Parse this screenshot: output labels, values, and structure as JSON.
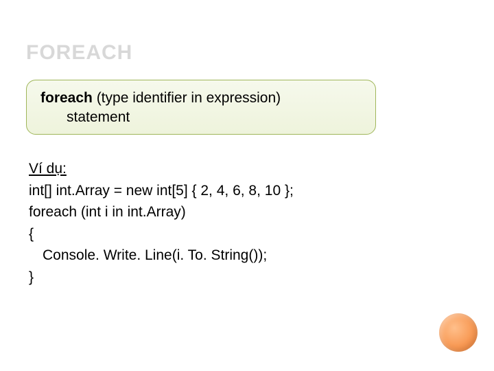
{
  "title": "FOREACH",
  "syntax": {
    "keyword": "foreach",
    "rest_line1": " (type identifier in expression)",
    "line2": "statement"
  },
  "example": {
    "label": "Ví dụ:",
    "line1": "int[] int.Array = new int[5] { 2, 4, 6, 8, 10 };",
    "line2": "foreach (int i in int.Array)",
    "line3": "{",
    "line4": "Console. Write. Line(i. To. String());",
    "line5": "}"
  }
}
